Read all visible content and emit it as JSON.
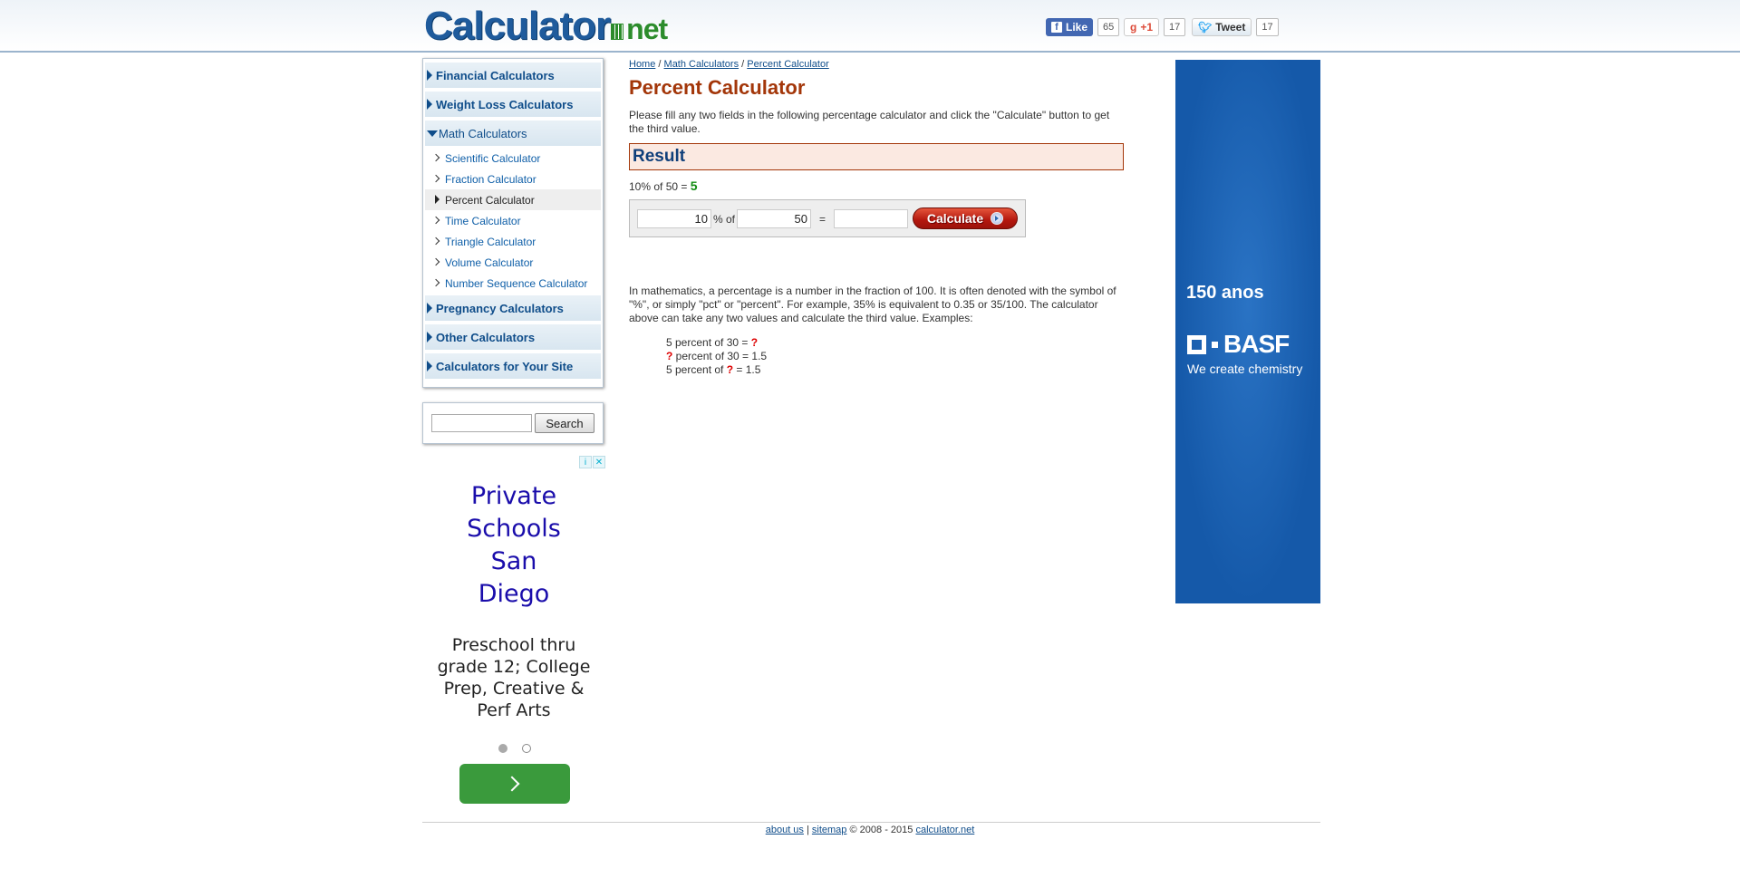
{
  "header": {
    "logo_main": "Calculator",
    "logo_suffix": "net",
    "social": {
      "facebook_label": "Like",
      "facebook_count": "65",
      "gplus_label": "+1",
      "gplus_count": "17",
      "twitter_label": "Tweet",
      "twitter_count": "17"
    }
  },
  "sidebar": {
    "categories_top": [
      "Financial Calculators",
      "Weight Loss Calculators"
    ],
    "open_category": "Math Calculators",
    "sub_items": [
      "Scientific Calculator",
      "Fraction Calculator",
      "Percent Calculator",
      "Time Calculator",
      "Triangle Calculator",
      "Volume Calculator",
      "Number Sequence Calculator"
    ],
    "active_sub": "Percent Calculator",
    "categories_bottom": [
      "Pregnancy Calculators",
      "Other Calculators",
      "Calculators for Your Site"
    ]
  },
  "search": {
    "value": "",
    "button_label": "Search"
  },
  "left_ad": {
    "headline": "Private Schools San Diego",
    "body": "Preschool thru grade 12; College Prep, Creative & Perf Arts",
    "info_icon": "i",
    "close_icon": "✕"
  },
  "breadcrumb": {
    "home": "Home",
    "sep": "/",
    "math": "Math Calculators",
    "current": "Percent Calculator"
  },
  "main": {
    "title": "Percent Calculator",
    "intro": "Please fill any two fields in the following percentage calculator and click the \"Calculate\" button to get the third value.",
    "result_header": "Result",
    "result_expression": "10% of 50 = ",
    "result_value": "5",
    "form": {
      "percent_value": "10",
      "percent_of_label": "% of",
      "of_value": "50",
      "equals_label": "=",
      "result_value": "",
      "calculate_label": "Calculate"
    },
    "explanation": "In mathematics, a percentage is a number in the fraction of 100. It is often denoted with the symbol of \"%\", or simply \"pct\" or \"percent\". For example, 35% is equivalent to 0.35 or 35/100. The calculator above can take any two values and calculate the third value. Examples:",
    "examples": [
      {
        "before": "5 percent of 30 = ",
        "q": "?",
        "after": ""
      },
      {
        "before": "",
        "q": "?",
        "after": " percent of 30 = 1.5"
      },
      {
        "before": "5 percent of ",
        "q": "?",
        "after": " = 1.5"
      }
    ]
  },
  "right_ad": {
    "anos": "150 anos",
    "brand": "BASF",
    "tagline": "We create chemistry",
    "color": "#1559a9"
  },
  "footer": {
    "about": "about us",
    "sep": "|",
    "sitemap": "sitemap",
    "copyright": "© 2008 - 2015",
    "site": "calculator.net"
  }
}
